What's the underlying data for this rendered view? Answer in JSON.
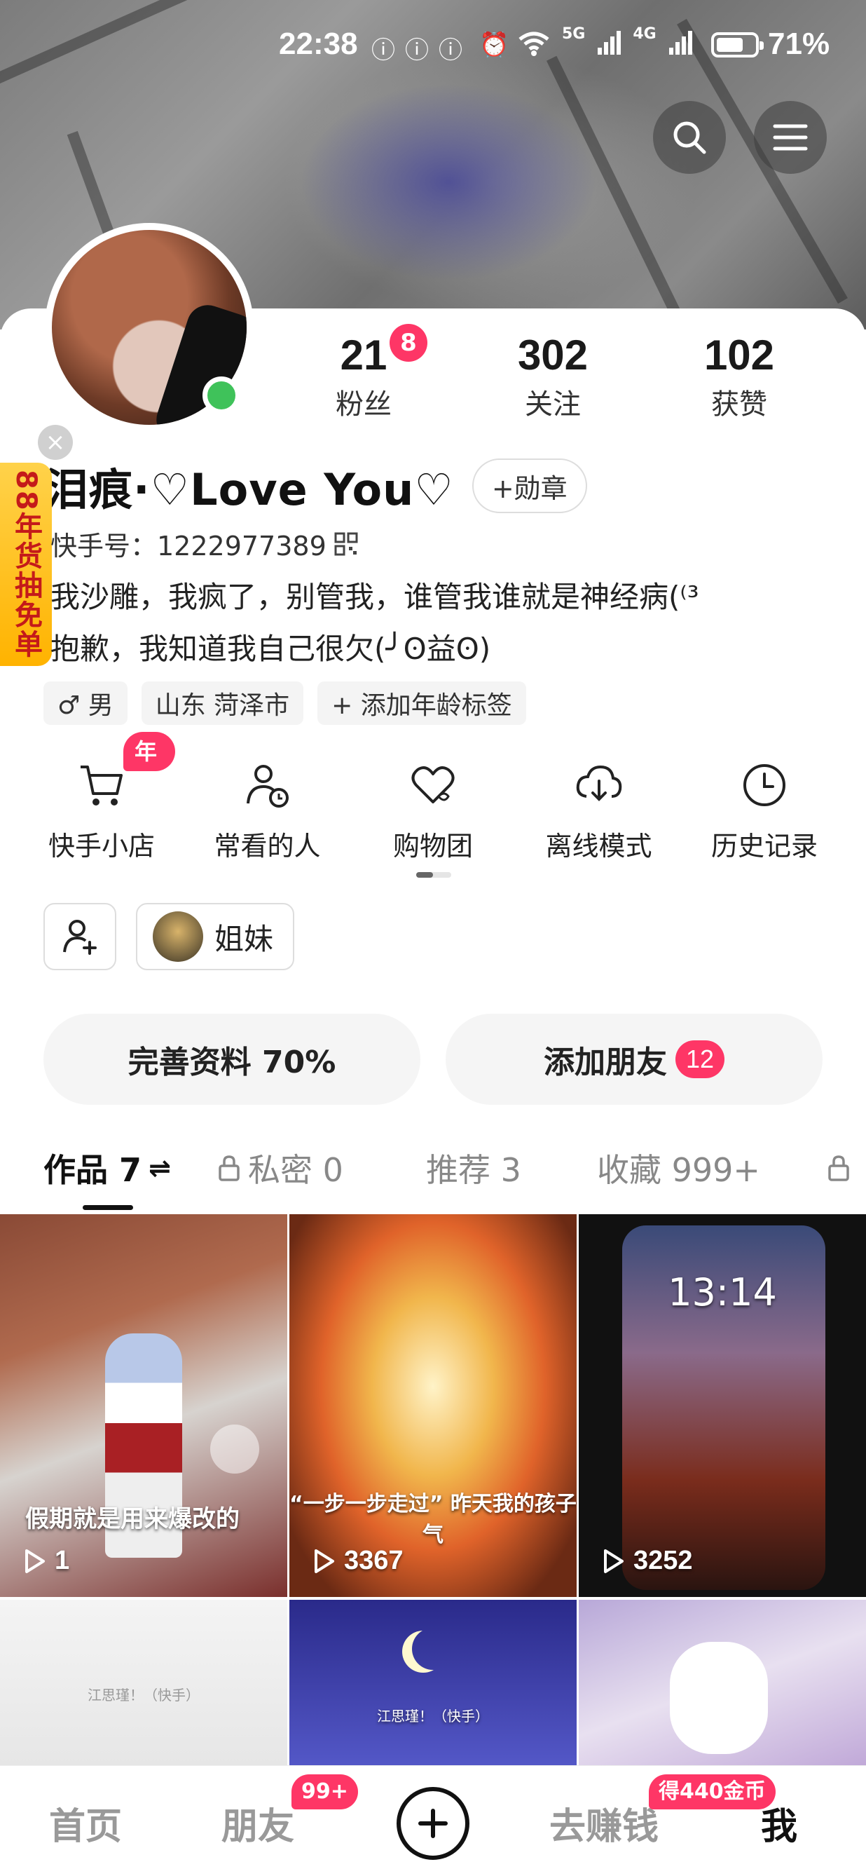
{
  "status_bar": {
    "time": "22:38",
    "network_5g": "5G",
    "network_4g": "4G",
    "battery": "71%",
    "battery_level": 0.71
  },
  "profile": {
    "name": "泪痕·♡Love You♡",
    "medal_label": "+勋章",
    "account": "快手号：1222977389",
    "bio_lines": [
      "我沙雕，我疯了，别管我，谁管我谁就是神经病(⁽³",
      "抱歉，我知道我自己很欠(╯ʘ益ʘ)"
    ],
    "stats": [
      {
        "value": "21",
        "label": "粉丝",
        "badge": "8"
      },
      {
        "value": "302",
        "label": "关注"
      },
      {
        "value": "102",
        "label": "获赞"
      }
    ],
    "tags": [
      {
        "icon": "male-icon",
        "text": "♂ 男"
      },
      {
        "text": "山东 菏泽市"
      },
      {
        "icon": "plus-icon",
        "text": "+ 添加年龄标签"
      }
    ]
  },
  "promo": {
    "text": "88年货抽免单"
  },
  "tools": [
    {
      "label": "快手小店",
      "icon": "cart-icon",
      "badge": "年货"
    },
    {
      "label": "常看的人",
      "icon": "person-clock-icon"
    },
    {
      "label": "购物团",
      "icon": "heart-group-icon"
    },
    {
      "label": "离线模式",
      "icon": "cloud-download-icon"
    },
    {
      "label": "历史记录",
      "icon": "clock-icon"
    }
  ],
  "group_chip": {
    "label": "姐妹"
  },
  "actions": {
    "complete_profile": "完善资料 70%",
    "add_friends": "添加朋友",
    "add_friends_count": "12"
  },
  "tabs": [
    {
      "label": "作品 7",
      "active": true
    },
    {
      "label": "私密 0",
      "locked": true
    },
    {
      "label": "推荐 3"
    },
    {
      "label": "收藏 999+"
    }
  ],
  "videos": [
    {
      "caption": "假期就是用来爆改的",
      "plays": "1"
    },
    {
      "caption": "“一步一步走过” 昨天我的孩子气",
      "plays": "3367"
    },
    {
      "caption": "13:14",
      "plays": "3252"
    },
    {
      "caption": "江思瑾！（快手）",
      "plays": ""
    },
    {
      "caption": "江思瑾！（快手）",
      "plays": ""
    },
    {
      "caption": "",
      "plays": ""
    }
  ],
  "bottom_nav": {
    "home": "首页",
    "friends": "朋友",
    "friends_badge": "99+",
    "earn": "去赚钱",
    "earn_badge": "得440金币",
    "me": "我"
  },
  "colors": {
    "accent": "#fe3666",
    "online": "#3fc25a"
  }
}
